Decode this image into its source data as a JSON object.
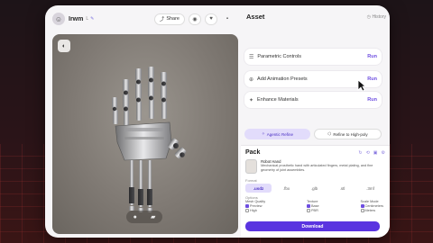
{
  "header": {
    "avatar_initial": "☺",
    "project_name": "Irwm",
    "project_tag": "L",
    "project_badge": "✎",
    "share_label": "Share"
  },
  "viewport": {
    "badge_icon": "layers-icon"
  },
  "asset_panel": {
    "title": "Asset",
    "history_label": "History",
    "rows": [
      {
        "label": "Parametric Controls",
        "action": "Run"
      },
      {
        "label": "Add Animation Presets",
        "action": "Run"
      },
      {
        "label": "Enhance Materials",
        "action": "Run"
      }
    ],
    "agentic_label": "Agentic Refine",
    "refine_label": "Refine to High-poly"
  },
  "pack": {
    "title": "Pack",
    "item_name": "Robot Hand",
    "item_desc": "Mechanical prosthetic hand with articulated fingers, metal plating, and fine geometry of joint assemblies.",
    "format_label": "Format",
    "formats": [
      ".usdz",
      ".fbx",
      ".glb",
      ".stl",
      ".3mf"
    ],
    "selected_format": ".usdz",
    "options_label": "Options",
    "options": [
      {
        "title": "Mesh Quality",
        "values": [
          "Preview",
          "High"
        ]
      },
      {
        "title": "Texture",
        "values": [
          "Base",
          "PBR"
        ]
      },
      {
        "title": "Scale Mode",
        "values": [
          "Centimeters",
          "Meters"
        ]
      }
    ],
    "download_label": "Download"
  },
  "colors": {
    "accent": "#5a34e0",
    "accent_soft": "#e2dcfb",
    "run_text": "#6d4de0"
  }
}
